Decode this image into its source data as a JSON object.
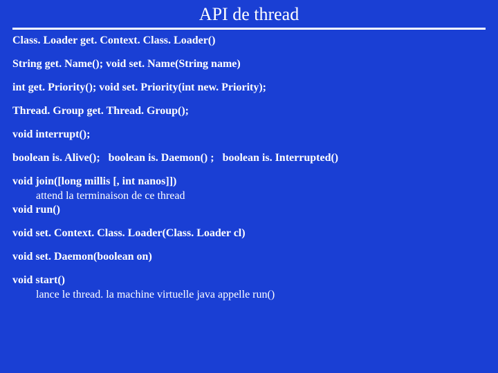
{
  "title": "API de thread",
  "api": {
    "l1": "Class. Loader get. Context. Class. Loader()",
    "l2": "String get. Name();  void set. Name(String name)",
    "l3": "int get. Priority();  void set. Priority(int new. Priority);",
    "l4": "Thread. Group get. Thread. Group();",
    "l5": "void interrupt();",
    "l6a": "boolean is. Alive();",
    "l6b": "boolean is. Daemon() ;",
    "l6c": "boolean is. Interrupted()",
    "l7": "void join([long millis [, int nanos]])",
    "l7note": "attend la terminaison de ce thread",
    "l8": "void run()",
    "l9": "void set. Context. Class. Loader(Class. Loader cl)",
    "l10": "void set. Daemon(boolean on)",
    "l11": "void start()",
    "l11note": "lance le thread. la machine virtuelle java appelle run()"
  }
}
